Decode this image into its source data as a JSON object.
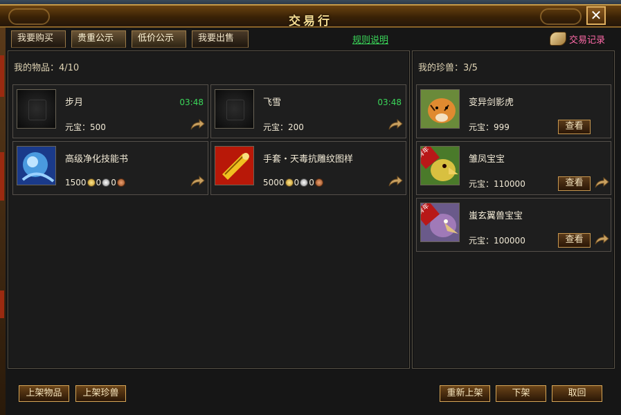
{
  "title": "交易行",
  "close_label": "✕",
  "tabs": [
    {
      "label": "我要购买",
      "active": false
    },
    {
      "label": "贵重公示",
      "active": true
    },
    {
      "label": "低价公示",
      "active": true
    },
    {
      "label": "我要出售",
      "active": false
    }
  ],
  "rules_link": "规则说明",
  "trade_record": "交易记录",
  "my_items": {
    "header": "我的物品：4/10",
    "items": [
      {
        "name": "步月",
        "time": "03:48",
        "price_label": "元宝：",
        "price": "500",
        "icon": "empty-slot-icon"
      },
      {
        "name": "飞雪",
        "time": "03:48",
        "price_label": "元宝：",
        "price": "200",
        "icon": "empty-slot-icon"
      },
      {
        "name": "高级净化技能书",
        "gold": "1500",
        "silver": "0",
        "copper": "0",
        "icon": "skill-book-icon"
      },
      {
        "name": "手套・天毒抗雕纹图样",
        "gold": "5000",
        "silver": "0",
        "copper": "0",
        "icon": "scroll-pattern-icon"
      }
    ]
  },
  "my_pets": {
    "header": "我的珍兽：3/5",
    "view_label": "查看",
    "pets": [
      {
        "name": "变异剑影虎",
        "price_label": "元宝：",
        "price": "999",
        "icon": "tiger-icon"
      },
      {
        "name": "雏凤宝宝",
        "price_label": "元宝：",
        "price": "110000",
        "icon": "phoenix-chick-icon",
        "tag": "青年"
      },
      {
        "name": "蚩玄翼兽宝宝",
        "price_label": "元宝：",
        "price": "100000",
        "icon": "wing-beast-icon",
        "tag": "青年"
      }
    ]
  },
  "buttons": {
    "list_item": "上架物品",
    "list_pet": "上架珍兽",
    "relist": "重新上架",
    "delist": "下架",
    "retrieve": "取回"
  },
  "colors": {
    "accent_gold": "#f4dc92",
    "timer_green": "#3bd85a",
    "record_pink": "#ff6aa8"
  }
}
